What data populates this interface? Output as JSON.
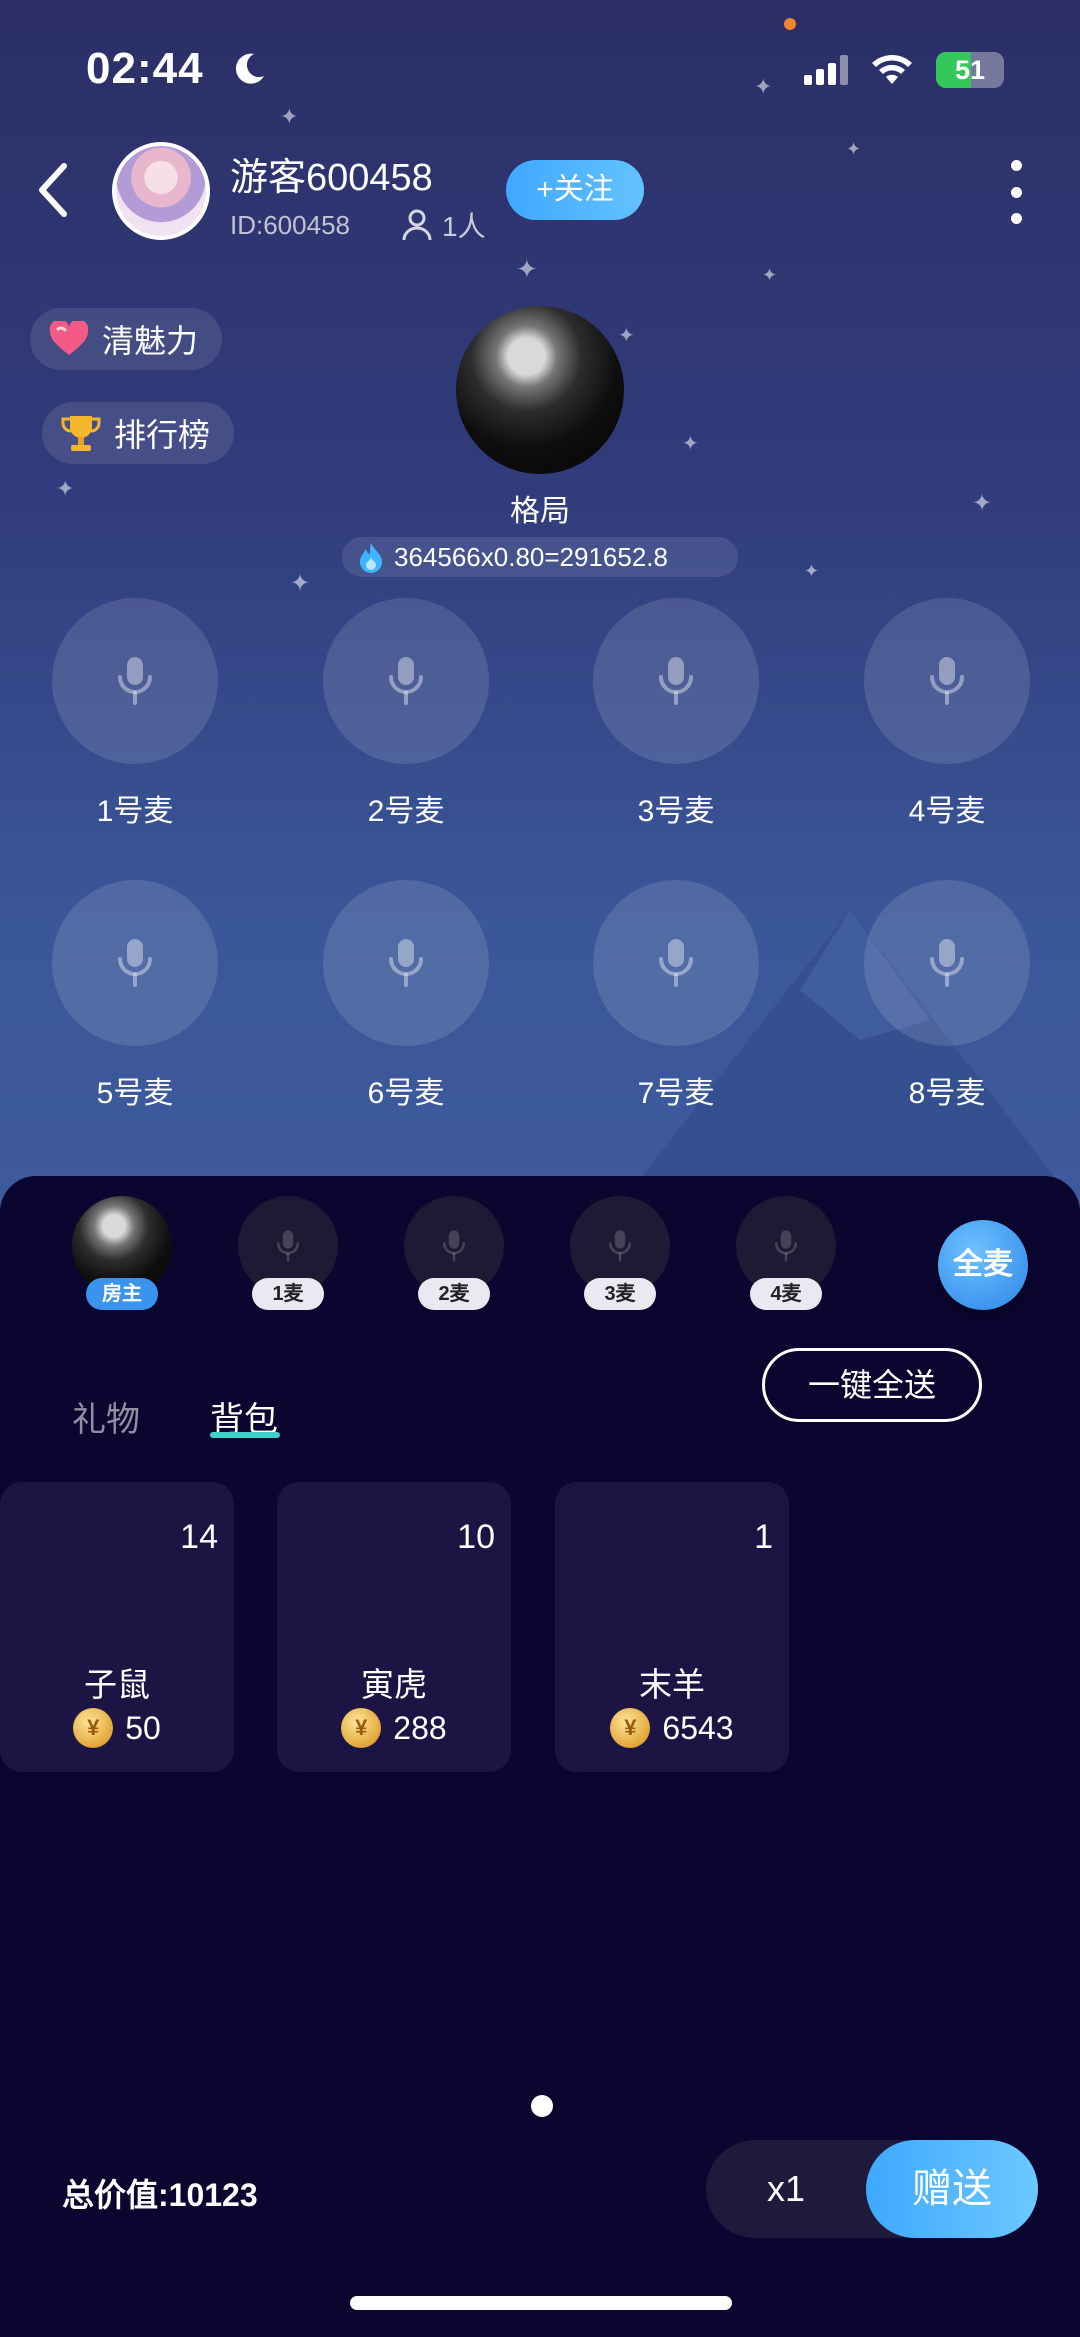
{
  "status_bar": {
    "time": "02:44",
    "battery": "51",
    "battery_level": 0.51
  },
  "header": {
    "host_name": "游客600458",
    "host_id": "ID:600458",
    "online_count": "1人",
    "follow_label": "+关注"
  },
  "pills": {
    "charm": "清魅力",
    "rank": "排行榜"
  },
  "owner": {
    "name": "格局",
    "score": "364566x0.80=291652.8"
  },
  "mic_seats": [
    {
      "label": "1号麦"
    },
    {
      "label": "2号麦"
    },
    {
      "label": "3号麦"
    },
    {
      "label": "4号麦"
    },
    {
      "label": "5号麦"
    },
    {
      "label": "6号麦"
    },
    {
      "label": "7号麦"
    },
    {
      "label": "8号麦"
    }
  ],
  "gift_targets": [
    {
      "label": "房主",
      "selected": true
    },
    {
      "label": "1麦"
    },
    {
      "label": "2麦"
    },
    {
      "label": "3麦"
    },
    {
      "label": "4麦"
    }
  ],
  "all_mic_label": "全麦",
  "tabs": {
    "gift": "礼物",
    "bag": "背包",
    "active": "背包"
  },
  "send_all_label": "一键全送",
  "items": [
    {
      "count": "14",
      "name": "子鼠",
      "price": "50"
    },
    {
      "count": "10",
      "name": "寅虎",
      "price": "288"
    },
    {
      "count": "1",
      "name": "末羊",
      "price": "6543"
    }
  ],
  "coin_symbol": "¥",
  "footer": {
    "total": "总价值:10123",
    "quantity": "x1",
    "send_label": "赠送"
  },
  "colors": {
    "accent_blue": "#3fa8ff",
    "tab_underline": "#3fd3c8",
    "sheet_bg": "#0b0630"
  }
}
